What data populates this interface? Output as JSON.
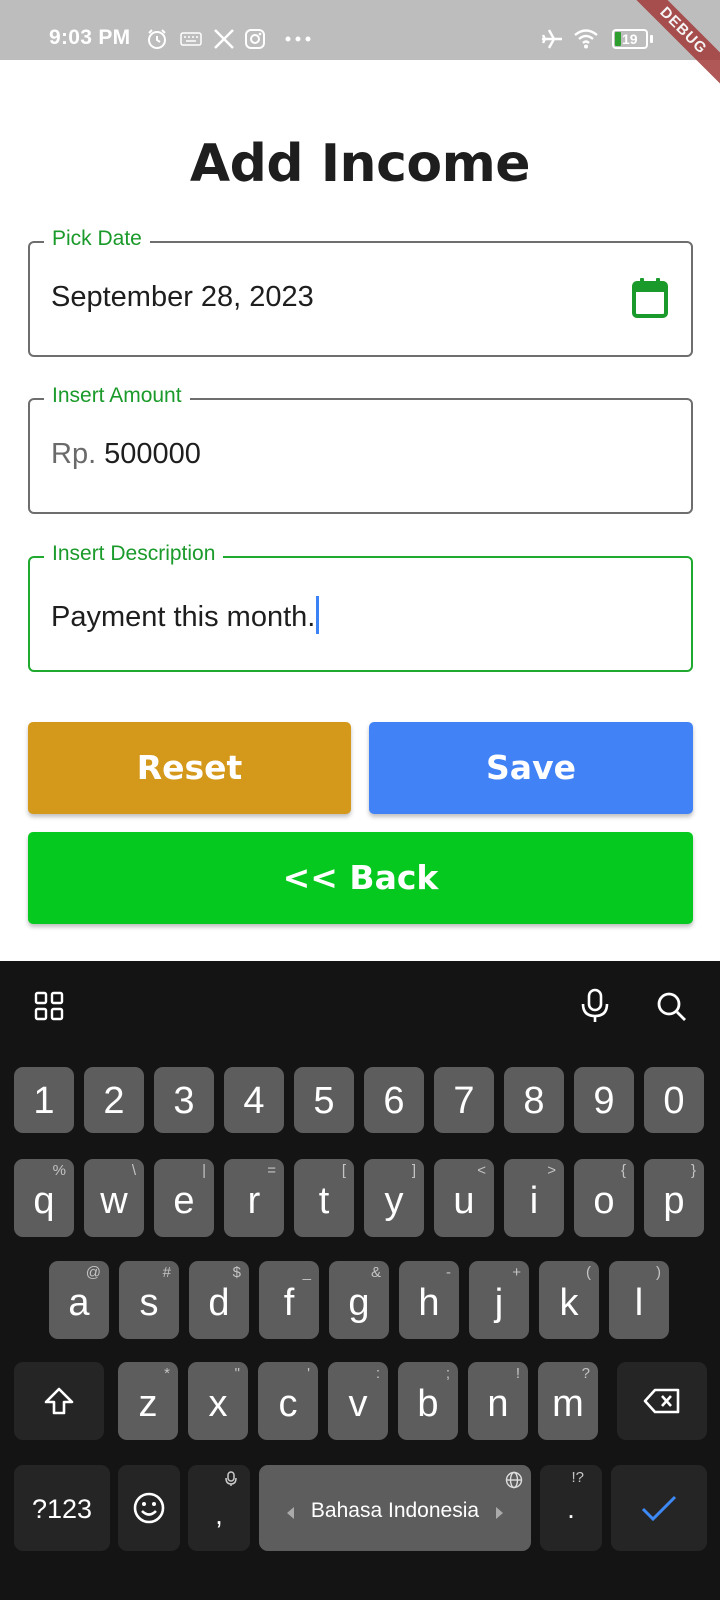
{
  "status_bar": {
    "time": "9:03 PM",
    "battery_level": "19",
    "debug_label": "DEBUG",
    "icons": [
      "alarm-icon",
      "keyboard-icon",
      "x-logo-icon",
      "instagram-icon",
      "more-dots-icon",
      "airplane-icon",
      "wifi-icon",
      "battery-icon"
    ]
  },
  "page": {
    "title": "Add Income"
  },
  "fields": {
    "date": {
      "label": "Pick Date",
      "value": "September 28, 2023",
      "icon": "calendar-icon"
    },
    "amount": {
      "label": "Insert Amount",
      "prefix": "Rp.",
      "value": "500000"
    },
    "description": {
      "label": "Insert Description",
      "value": "Payment this month."
    }
  },
  "buttons": {
    "reset": "Reset",
    "save": "Save",
    "back": "<< Back"
  },
  "colors": {
    "accent_green": "#1a9a2a",
    "reset": "#d4981a",
    "save": "#4183f6",
    "back": "#05c91f",
    "keyboard_bg": "#141414",
    "key_bg": "#5d5d5d"
  },
  "keyboard": {
    "row1": [
      {
        "main": "1"
      },
      {
        "main": "2"
      },
      {
        "main": "3"
      },
      {
        "main": "4"
      },
      {
        "main": "5"
      },
      {
        "main": "6"
      },
      {
        "main": "7"
      },
      {
        "main": "8"
      },
      {
        "main": "9"
      },
      {
        "main": "0"
      }
    ],
    "row2": [
      {
        "main": "q",
        "sub": "%"
      },
      {
        "main": "w",
        "sub": "\\"
      },
      {
        "main": "e",
        "sub": "|"
      },
      {
        "main": "r",
        "sub": "="
      },
      {
        "main": "t",
        "sub": "["
      },
      {
        "main": "y",
        "sub": "]"
      },
      {
        "main": "u",
        "sub": "<"
      },
      {
        "main": "i",
        "sub": ">"
      },
      {
        "main": "o",
        "sub": "{"
      },
      {
        "main": "p",
        "sub": "}"
      }
    ],
    "row3": [
      {
        "main": "a",
        "sub": "@"
      },
      {
        "main": "s",
        "sub": "#"
      },
      {
        "main": "d",
        "sub": "$"
      },
      {
        "main": "f",
        "sub": "_"
      },
      {
        "main": "g",
        "sub": "&"
      },
      {
        "main": "h",
        "sub": "-"
      },
      {
        "main": "j",
        "sub": "+"
      },
      {
        "main": "k",
        "sub": "("
      },
      {
        "main": "l",
        "sub": ")"
      }
    ],
    "row4": [
      {
        "main": "z",
        "sub": "*"
      },
      {
        "main": "x",
        "sub": "\""
      },
      {
        "main": "c",
        "sub": "'"
      },
      {
        "main": "v",
        "sub": ":"
      },
      {
        "main": "b",
        "sub": ";"
      },
      {
        "main": "n",
        "sub": "!"
      },
      {
        "main": "m",
        "sub": "?"
      }
    ],
    "symbols_key": "?123",
    "comma_key": ",",
    "space_label": "Bahasa Indonesia",
    "period_key": ".",
    "period_sub": "!?"
  }
}
